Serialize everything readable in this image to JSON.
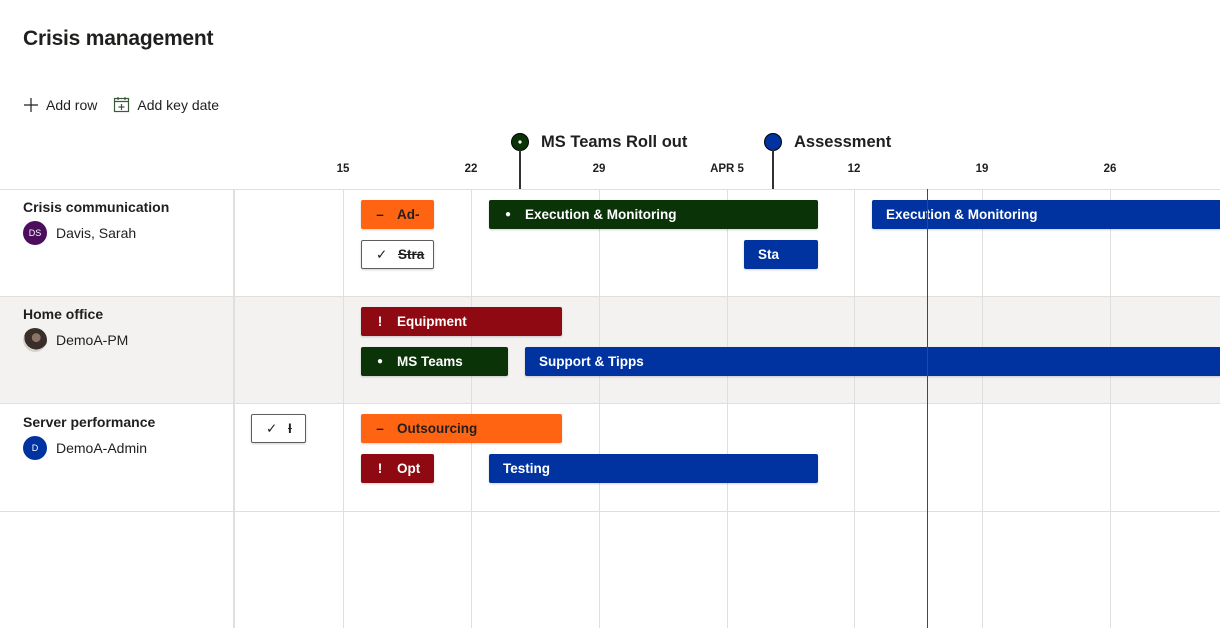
{
  "page": {
    "title": "Crisis management"
  },
  "toolbar": {
    "add_row_label": "Add row",
    "add_key_date_label": "Add key date"
  },
  "timeline": {
    "ticks": [
      "15",
      "22",
      "29",
      "APR 5",
      "12",
      "19",
      "26"
    ],
    "key_dates": [
      {
        "label": "MS Teams Roll out",
        "color": "#0b3308",
        "dot": true
      },
      {
        "label": "Assessment",
        "color": "#0032a0",
        "dot": false
      }
    ],
    "today_color": "#c50f1f"
  },
  "colors": {
    "orange": "#ff6412",
    "green": "#0b3308",
    "red": "#8e0912",
    "blue": "#0032a0",
    "row_alt_bg": "#f3f2f1"
  },
  "rows": [
    {
      "name": "Crisis communication",
      "owner": "Davis, Sarah",
      "avatar": {
        "type": "initials",
        "text": "DS",
        "color": "#4b0d5c"
      },
      "tasks": [
        {
          "label": "Ad-",
          "color": "orange",
          "icon": "minus",
          "text_color": "#201f1e"
        },
        {
          "label": "Stra",
          "color": "outline",
          "icon": "check"
        },
        {
          "label": "Execution & Monitoring",
          "color": "green",
          "icon": "dot"
        },
        {
          "label": "Sta",
          "color": "blue",
          "icon": "none"
        },
        {
          "label": "Execution & Monitoring",
          "color": "blue",
          "icon": "none"
        }
      ]
    },
    {
      "name": "Home office",
      "owner": "DemoA-PM",
      "avatar": {
        "type": "photo",
        "text": "",
        "color": "#5a4a42"
      },
      "tasks": [
        {
          "label": "Equipment",
          "color": "red",
          "icon": "exclamation"
        },
        {
          "label": "MS Teams",
          "color": "green",
          "icon": "dot"
        },
        {
          "label": "Support & Tipps",
          "color": "blue",
          "icon": "none"
        }
      ]
    },
    {
      "name": "Server performance",
      "owner": "DemoA-Admin",
      "avatar": {
        "type": "initials",
        "text": "D",
        "color": "#0032a0"
      },
      "tasks": [
        {
          "label": "I",
          "color": "outline",
          "icon": "check"
        },
        {
          "label": "Outsourcing",
          "color": "orange",
          "icon": "minus",
          "text_color": "#201f1e"
        },
        {
          "label": "Opt",
          "color": "red",
          "icon": "exclamation"
        },
        {
          "label": "Testing",
          "color": "blue",
          "icon": "none"
        }
      ]
    }
  ]
}
